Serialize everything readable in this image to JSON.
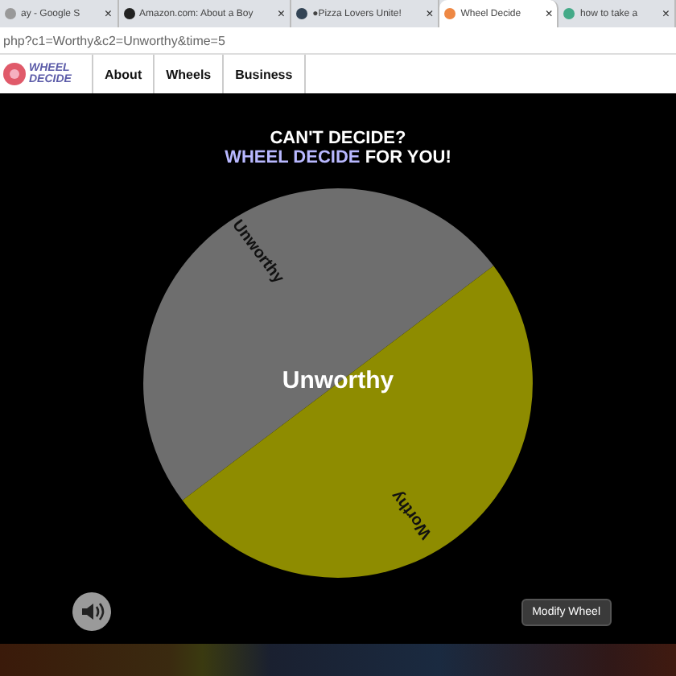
{
  "browser": {
    "tabs": [
      {
        "title": "ay - Google S",
        "close": "×",
        "selected": false
      },
      {
        "title": "Amazon.com: About a Boy",
        "close": "×",
        "selected": false
      },
      {
        "title": "●Pizza Lovers Unite!",
        "close": "×",
        "selected": false
      },
      {
        "title": "Wheel Decide",
        "close": "×",
        "selected": true
      },
      {
        "title": "how to take a",
        "close": "×",
        "selected": false
      }
    ],
    "address": "php?c1=Worthy&c2=Unworthy&time=5"
  },
  "nav": {
    "logo": "WHEEL DECIDE",
    "items": [
      "About",
      "Wheels",
      "Business"
    ]
  },
  "heading": {
    "line1": "CAN'T DECIDE?",
    "brand": "WHEEL DECIDE",
    "rest": "FOR YOU!"
  },
  "wheel": {
    "result": "Unworthy",
    "segments": [
      {
        "label": "Unworthy",
        "color": "#6e6e6e"
      },
      {
        "label": "Worthy",
        "color": "#8e8c00"
      }
    ]
  },
  "footer": {
    "button": "Modify Wheel"
  }
}
